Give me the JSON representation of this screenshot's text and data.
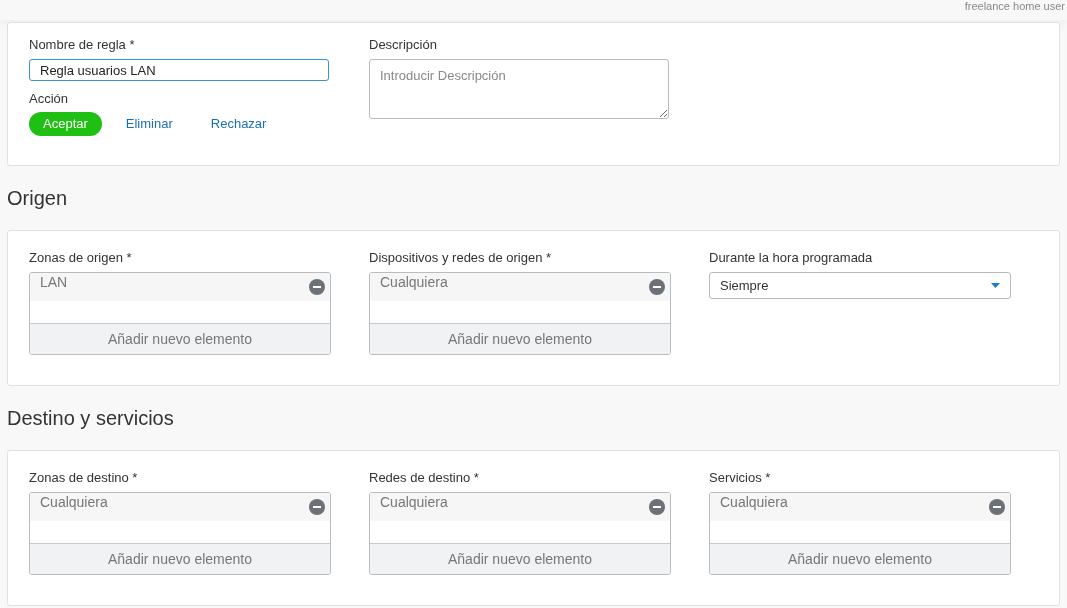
{
  "header": {
    "user": "freelance home user"
  },
  "rule": {
    "name_label": "Nombre de regla *",
    "name_value": "Regla usuarios LAN",
    "description_label": "Descripción",
    "description_placeholder": "Introducir Descripción",
    "action_label": "Acción",
    "actions": [
      {
        "label": "Aceptar",
        "selected": true
      },
      {
        "label": "Eliminar",
        "selected": false
      },
      {
        "label": "Rechazar",
        "selected": false
      }
    ]
  },
  "sections": [
    {
      "title": "Origen",
      "fields": [
        {
          "kind": "list",
          "label": "Zonas de origen *",
          "items": [
            "LAN"
          ],
          "add": "Añadir nuevo elemento"
        },
        {
          "kind": "list",
          "label": "Dispositivos y redes de origen *",
          "items": [
            "Cualquiera"
          ],
          "add": "Añadir nuevo elemento"
        },
        {
          "kind": "select",
          "label": "Durante la hora programada",
          "value": "Siempre"
        }
      ]
    },
    {
      "title": "Destino y servicios",
      "fields": [
        {
          "kind": "list",
          "label": "Zonas de destino *",
          "items": [
            "Cualquiera"
          ],
          "add": "Añadir nuevo elemento"
        },
        {
          "kind": "list",
          "label": "Redes de destino *",
          "items": [
            "Cualquiera"
          ],
          "add": "Añadir nuevo elemento"
        },
        {
          "kind": "list",
          "label": "Servicios *",
          "items": [
            "Cualquiera"
          ],
          "add": "Añadir nuevo elemento"
        }
      ]
    }
  ]
}
